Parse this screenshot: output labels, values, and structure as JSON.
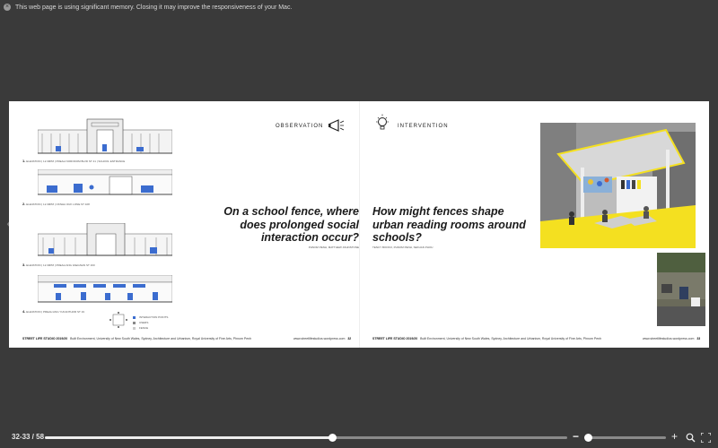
{
  "browser": {
    "memory_warning": "This web page is using significant memory. Closing it may improve the responsiveness of your Mac."
  },
  "left_page": {
    "section_label": "OBSERVATION",
    "sketch_captions": [
      {
        "num": "1.",
        "text": "ELEVATION | 12.30PM | PREAH NORODOM BLVD ST 41 | SCHOOL ENTRANCE"
      },
      {
        "num": "2.",
        "text": "ELEVATION | 12.30PM | OKNHA OUK LONE ST 108"
      },
      {
        "num": "3.",
        "text": "ELEVATION | 12.30PM | PREAH ANG FAEGNAN ST 160"
      },
      {
        "num": "4.",
        "text": "ELEVATION | PREAH ANG YUKANTHOR ST 19"
      }
    ],
    "legend": [
      "INTERACTION POINTS",
      "USERS",
      "FENCE"
    ],
    "question": "On a school fence, where does prolonged social interaction occur?",
    "authors": "PHNOM PENH, MATTHEW JOHNSTONE",
    "footer_title": "STREET LIFE STUDIO 2019/20",
    "footer_text": "Built Environment, University of New South Wales, Sydney. Architecture and Urbanism, Royal University of Fine Arts, Phnom Penh",
    "footer_url": "www.streetlifestudios.wordpress.com",
    "page_number": "32"
  },
  "right_page": {
    "section_label": "INTERVENTION",
    "question": "How might fences shape urban reading rooms around schools?",
    "authors": "TENCY BOOKO, PHNOM PENH, SEKUAN PHOU",
    "footer_title": "STREET LIFE STUDIO 2019/20",
    "footer_text": "Built Environment, University of New South Wales, Sydney. Architecture and Urbanism, Royal University of Fine Arts, Phnom Penh",
    "footer_url": "www.streetlifestudios.wordpress.com",
    "page_number": "33"
  },
  "viewer": {
    "page_indicator": "32-33 / 58",
    "progress": 0.55,
    "zoom_level": 0
  },
  "icons": {
    "left_arrow": "chevron-left-icon",
    "right_arrow": "chevron-right-icon",
    "megaphone": "megaphone-icon",
    "lightbulb": "lightbulb-icon"
  },
  "colors": {
    "accent_yellow": "#f4e020",
    "sketch_blue": "#3b6ccf",
    "page_bg": "#ffffff",
    "viewer_bg": "#3a3a3a"
  }
}
